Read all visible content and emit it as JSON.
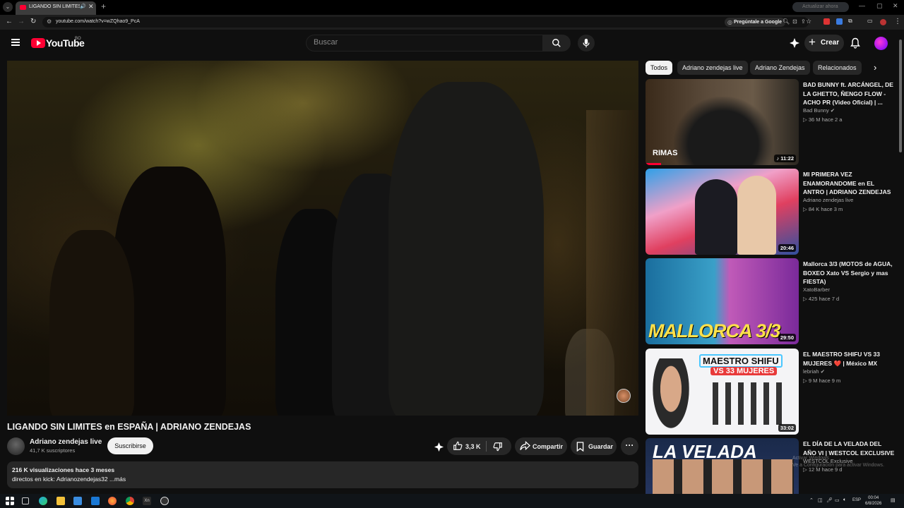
{
  "browser": {
    "tab_title": "LIGANDO SIN LIMITES en E",
    "url": "youtube.com/watch?v=wZQhao9_PcA",
    "ask_google": "Pregúntale a Google",
    "profile_label": "Actualizar ahora"
  },
  "header": {
    "logo_text": "YouTube",
    "country_code": "BO",
    "search_placeholder": "Buscar",
    "create_label": "Crear"
  },
  "video": {
    "title": "LIGANDO SIN LIMITES en ESPAÑA | ADRIANO ZENDEJAS",
    "channel": "Adriano zendejas live",
    "subscribers": "41,7 K suscriptores",
    "subscribe_label": "Suscribirse",
    "likes": "3,3 K",
    "share_label": "Compartir",
    "save_label": "Guardar",
    "views_line": "216 K visualizaciones  hace 3 meses",
    "description": "directos en kick: Adrianozendejas32 ...más"
  },
  "chips": [
    "Todos",
    "Adriano zendejas live",
    "Adriano Zendejas",
    "Relacionados"
  ],
  "recommendations": [
    {
      "title": "BAD BUNNY ft. ARCÁNGEL, DE LA GHETTO, ÑENGO FLOW - ACHO PR (Video Oficial) | ...",
      "channel": "Bad Bunny",
      "meta": "36 M  hace 2 a",
      "duration": "11:22",
      "thumb_text": "RIMAS"
    },
    {
      "title": "MI PRIMERA VEZ ENAMORANDOME en EL ANTRO | ADRIANO ZENDEJAS",
      "channel": "Adriano zendejas live",
      "meta": "84 K  hace 3 m",
      "duration": "20:46",
      "thumb_text": ""
    },
    {
      "title": "Mallorca 3/3 (MOTOS de AGUA, BOXEO Xato VS Sergio y mas FIESTA)",
      "channel": "XatoBarber",
      "meta": "425  hace 7 d",
      "duration": "29:50",
      "thumb_text": "MALLORCA 3/3"
    },
    {
      "title": "EL MAESTRO SHIFU VS 33 MUJERES ❤️ | México MX",
      "channel": "lebriah",
      "meta": "9 M  hace 9 m",
      "duration": "33:02",
      "thumb_text": "MAESTRO SHIFU",
      "thumb_text2": "VS 33 MUJERES"
    },
    {
      "title": "EL DÍA DE LA VELADA DEL AÑO VI | WESTCOL EXCLUSIVE",
      "channel": "WESTCOL Exclusive",
      "meta": "12 M  hace 9 d",
      "duration": "",
      "thumb_text": "LA VELADA"
    }
  ],
  "taskbar": {
    "lang": "ESP",
    "time": "00:04",
    "date": "6/8/2026"
  },
  "watermark": {
    "line1": "Activar Windows",
    "line2": "Ve a Configuración para activar Windows."
  }
}
